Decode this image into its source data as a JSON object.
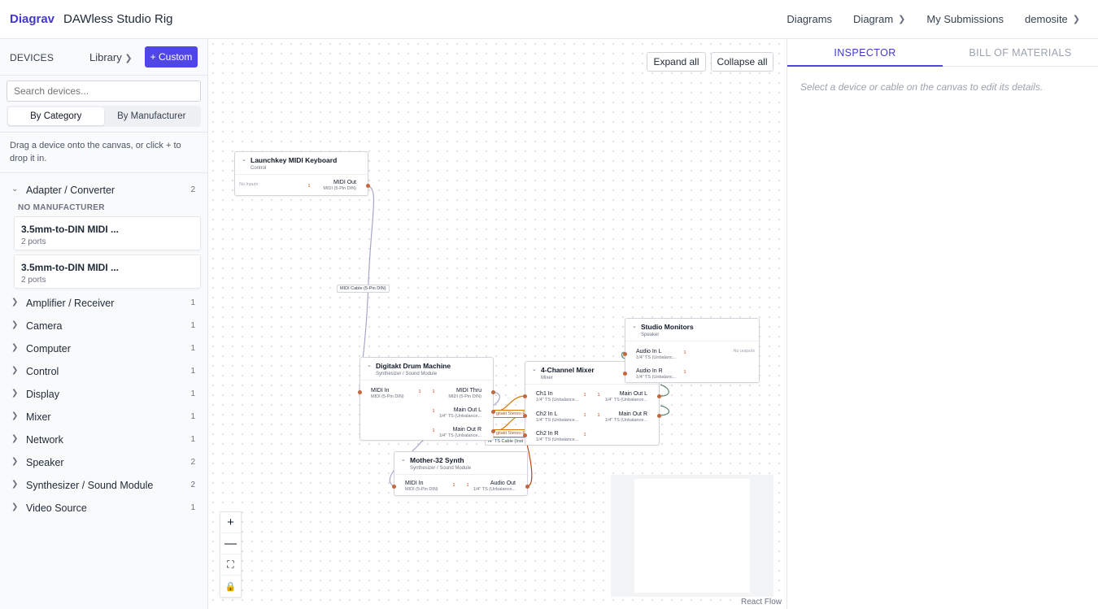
{
  "app": {
    "brand": "Diagrav",
    "title": "DAWless Studio Rig"
  },
  "nav": {
    "diagrams": "Diagrams",
    "diagram": "Diagram",
    "submissions": "My Submissions",
    "user": "demosite"
  },
  "sidebar": {
    "heading": "DEVICES",
    "library": "Library",
    "custom": "+ Custom",
    "search_placeholder": "Search devices...",
    "toggle": {
      "by_category": "By Category",
      "by_manufacturer": "By Manufacturer"
    },
    "hint": "Drag a device onto the canvas, or click + to drop it in.",
    "expanded": {
      "label": "Adapter / Converter",
      "count": "2",
      "manufacturer": "NO MANUFACTURER",
      "devices": [
        {
          "name": "3.5mm-to-DIN MIDI ...",
          "ports": "2 ports"
        },
        {
          "name": "3.5mm-to-DIN MIDI ...",
          "ports": "2 ports"
        }
      ]
    },
    "categories": [
      {
        "label": "Amplifier / Receiver",
        "count": "1"
      },
      {
        "label": "Camera",
        "count": "1"
      },
      {
        "label": "Computer",
        "count": "1"
      },
      {
        "label": "Control",
        "count": "1"
      },
      {
        "label": "Display",
        "count": "1"
      },
      {
        "label": "Mixer",
        "count": "1"
      },
      {
        "label": "Network",
        "count": "1"
      },
      {
        "label": "Speaker",
        "count": "2"
      },
      {
        "label": "Synthesizer / Sound Module",
        "count": "2"
      },
      {
        "label": "Video Source",
        "count": "1"
      }
    ]
  },
  "canvas": {
    "expand_all": "Expand all",
    "collapse_all": "Collapse all",
    "attribution": "React Flow",
    "nodes": {
      "keyboard": {
        "title": "Launchkey MIDI Keyboard",
        "category": "Control",
        "no_inputs": "No inputs",
        "out": {
          "name": "MIDI Out",
          "type": "MIDI (5-Pin DIN)",
          "badge": "1"
        }
      },
      "drum": {
        "title": "Digitakt Drum Machine",
        "category": "Synthesizer / Sound Module",
        "in": {
          "name": "MIDI In",
          "type": "MIDI (5-Pin DIN)",
          "badge": "1"
        },
        "thru": {
          "name": "MIDI Thru",
          "type": "MIDI (5-Pin DIN)",
          "badge": "1"
        },
        "out_l": {
          "name": "Main Out L",
          "type": "1/4\" TS (Unbalance...",
          "badge": "1"
        },
        "out_r": {
          "name": "Main Out R",
          "type": "1/4\" TS (Unbalance...",
          "badge": "1"
        }
      },
      "mixer": {
        "title": "4-Channel Mixer",
        "category": "Mixer",
        "ch1": {
          "name": "Ch1 In",
          "type": "1/4\" TS (Unbalance...",
          "badge": "1"
        },
        "ch2l": {
          "name": "Ch2 In L",
          "type": "1/4\" TS (Unbalance...",
          "badge": "1"
        },
        "ch2r": {
          "name": "Ch2 In R",
          "type": "1/4\" TS (Unbalance...",
          "badge": "1"
        },
        "out_l": {
          "name": "Main Out L",
          "type": "1/4\" TS (Unbalance...",
          "badge": "1"
        },
        "out_r": {
          "name": "Main Out R",
          "type": "1/4\" TS (Unbalance...",
          "badge": "1"
        }
      },
      "monitors": {
        "title": "Studio Monitors",
        "category": "Speaker",
        "no_outputs": "No outputs",
        "in_l": {
          "name": "Audio In L",
          "type": "1/4\" TS (Unbalanc...",
          "badge": "1"
        },
        "in_r": {
          "name": "Audio In R",
          "type": "1/4\" TS (Unbalanc...",
          "badge": "1"
        }
      },
      "synth": {
        "title": "Mother-32 Synth",
        "category": "Synthesizer / Sound Module",
        "in": {
          "name": "MIDI In",
          "type": "MIDI (5-Pin DIN)",
          "badge": "1"
        },
        "out": {
          "name": "Audio Out",
          "type": "1/4\" TS (Unbalance...",
          "badge": "1"
        }
      }
    },
    "edge_labels": {
      "midi": "MIDI Cable (5-Pin DIN)",
      "stereo_a": "gitakt Stereo P",
      "stereo_b": "gitakt Stereo P",
      "ts": "/4\" TS Cable (Inst"
    }
  },
  "inspector": {
    "tab_inspector": "INSPECTOR",
    "tab_bom": "BILL OF MATERIALS",
    "hint": "Select a device or cable on the canvas to edit its details."
  },
  "colors": {
    "accent": "#4f46e5",
    "port": "#c2673d",
    "cable_orange": "#d97706"
  }
}
